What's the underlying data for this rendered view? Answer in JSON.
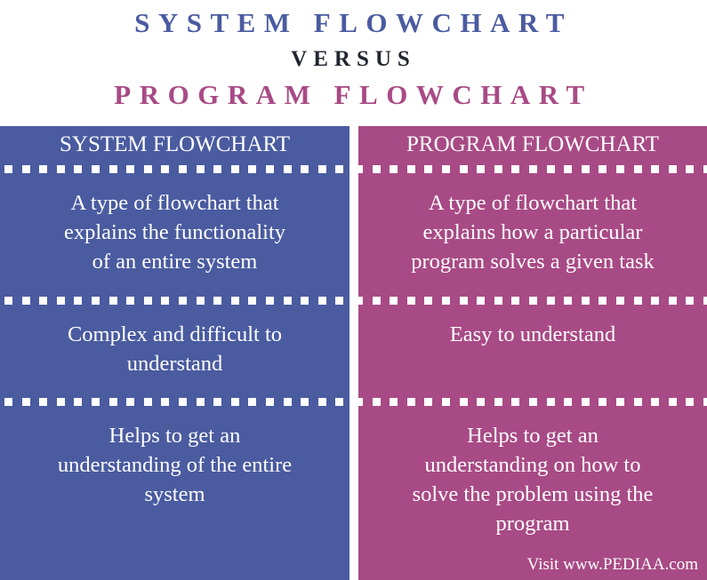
{
  "title": {
    "line1": "SYSTEM FLOWCHART",
    "line2": "VERSUS",
    "line3": "PROGRAM FLOWCHART"
  },
  "colors": {
    "system": "#4a5ba0",
    "program": "#a84a85",
    "versus": "#222630"
  },
  "columns": [
    {
      "header": "SYSTEM FLOWCHART",
      "rows": [
        [
          "A type of flowchart that",
          "explains the functionality",
          "of an entire system"
        ],
        [
          "Complex and difficult to",
          "understand"
        ],
        [
          "Helps to get an",
          "understanding of the entire",
          "system"
        ]
      ]
    },
    {
      "header": "PROGRAM FLOWCHART",
      "rows": [
        [
          "A type of flowchart that",
          "explains how a particular",
          "program solves a given task"
        ],
        [
          "Easy to understand"
        ],
        [
          "Helps to get an",
          "understanding on how to",
          "solve the problem using the",
          "program"
        ]
      ]
    }
  ],
  "credit": "Visit www.PEDIAA.com"
}
